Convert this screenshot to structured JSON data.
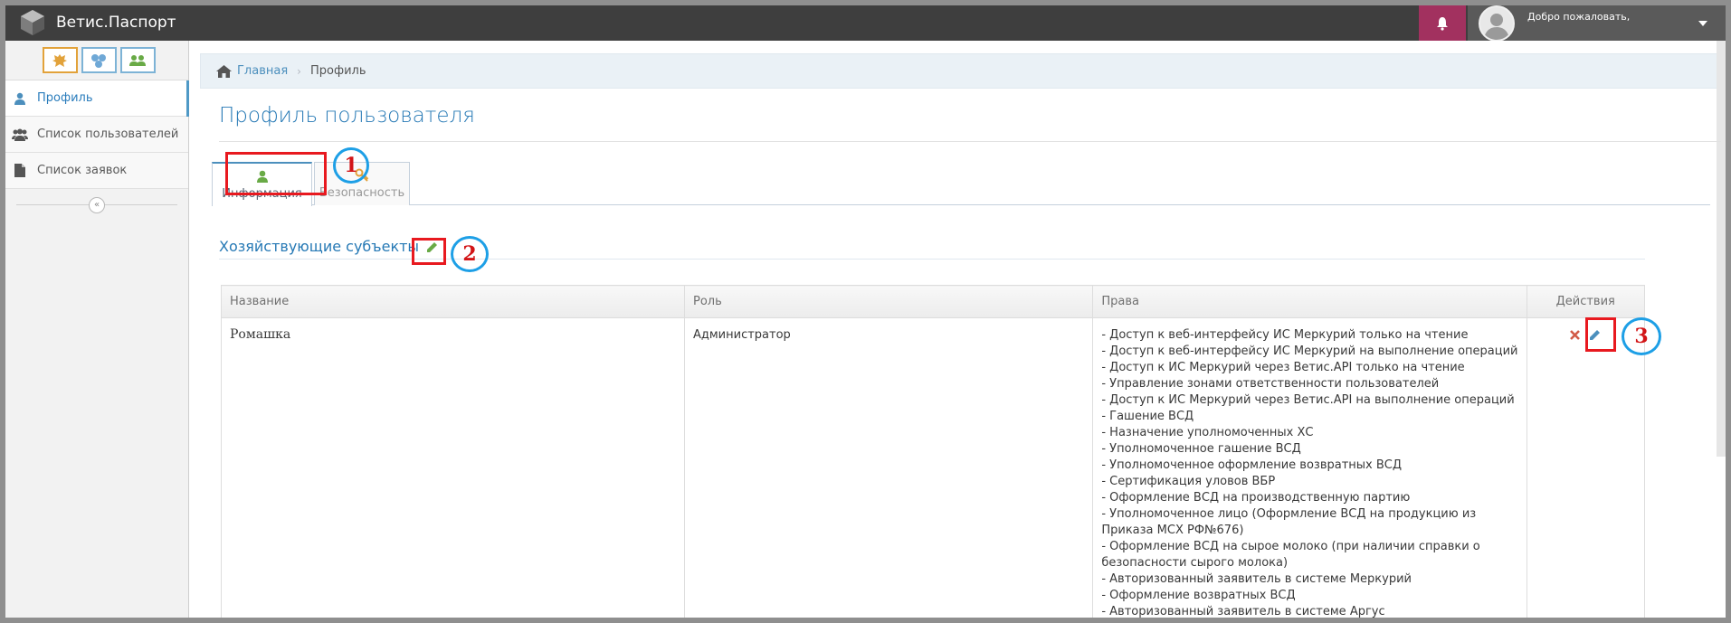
{
  "app": {
    "brand": "Ветис.Паспорт",
    "welcome": "Добро пожаловать,"
  },
  "sidebar": {
    "items": [
      {
        "label": "Профиль"
      },
      {
        "label": "Список пользователей"
      },
      {
        "label": "Список заявок"
      }
    ]
  },
  "breadcrumbs": {
    "home": "Главная",
    "current": "Профиль"
  },
  "page": {
    "title": "Профиль пользователя"
  },
  "tabs": [
    {
      "label": "Информация"
    },
    {
      "label": "Безопасность"
    }
  ],
  "section": {
    "title": "Хозяйствующие субъекты"
  },
  "table": {
    "headers": [
      "Название",
      "Роль",
      "Права",
      "Действия"
    ],
    "rows": [
      {
        "name": "Ромашка",
        "role": "Администратор",
        "rights": [
          "- Доступ к веб-интерфейсу ИС Меркурий только на чтение",
          "- Доступ к веб-интерфейсу ИС Меркурий на выполнение операций",
          "- Доступ к ИС Меркурий через Ветис.API только на чтение",
          "- Управление зонами ответственности пользователей",
          "- Доступ к ИС Меркурий через Ветис.API на выполнение операций",
          "- Гашение ВСД",
          "- Назначение уполномоченных ХС",
          "- Уполномоченное гашение ВСД",
          "- Уполномоченное оформление возвратных ВСД",
          "- Сертификация уловов ВБР",
          "- Оформление ВСД на производственную партию",
          "- Уполномоченное лицо (Оформление ВСД на продукцию из Приказа МСХ РФ№676)",
          "- Оформление ВСД на сырое молоко (при наличии справки о безопасности сырого молока)",
          "- Авторизованный заявитель в системе Меркурий",
          "- Оформление возвратных ВСД",
          "- Авторизованный заявитель в системе Аргус"
        ]
      }
    ]
  },
  "annotations": [
    "1",
    "2",
    "3"
  ],
  "colors": {
    "navbar": "#3e3e3e",
    "accent": "#2679b5",
    "notification": "#a2315f",
    "annotation_red": "#e8191f",
    "annotation_blue": "#1d9fe6"
  }
}
